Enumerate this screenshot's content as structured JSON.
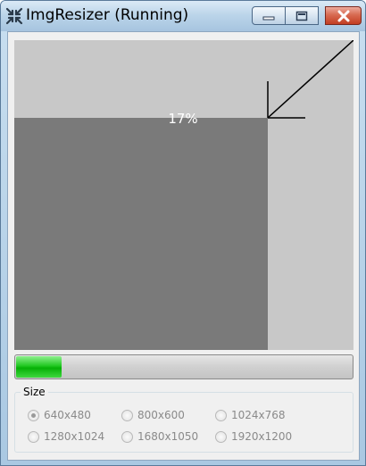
{
  "window": {
    "title": "ImgResizer (Running)",
    "icons": {
      "app": "shrink-arrows-icon",
      "minimize": "minimize-icon",
      "maximize": "maximize-icon",
      "close": "close-icon"
    }
  },
  "preview": {
    "progress_text": "17%",
    "arrow_icon": "resize-arrow-icon"
  },
  "progress": {
    "value": 0.14,
    "fill_color": "#06b006"
  },
  "size_group": {
    "label": "Size",
    "options": [
      {
        "label": "640x480",
        "checked": true
      },
      {
        "label": "800x600",
        "checked": false
      },
      {
        "label": "1024x768",
        "checked": false
      },
      {
        "label": "1280x1024",
        "checked": false
      },
      {
        "label": "1680x1050",
        "checked": false
      },
      {
        "label": "1920x1200",
        "checked": false
      }
    ],
    "enabled": false
  }
}
